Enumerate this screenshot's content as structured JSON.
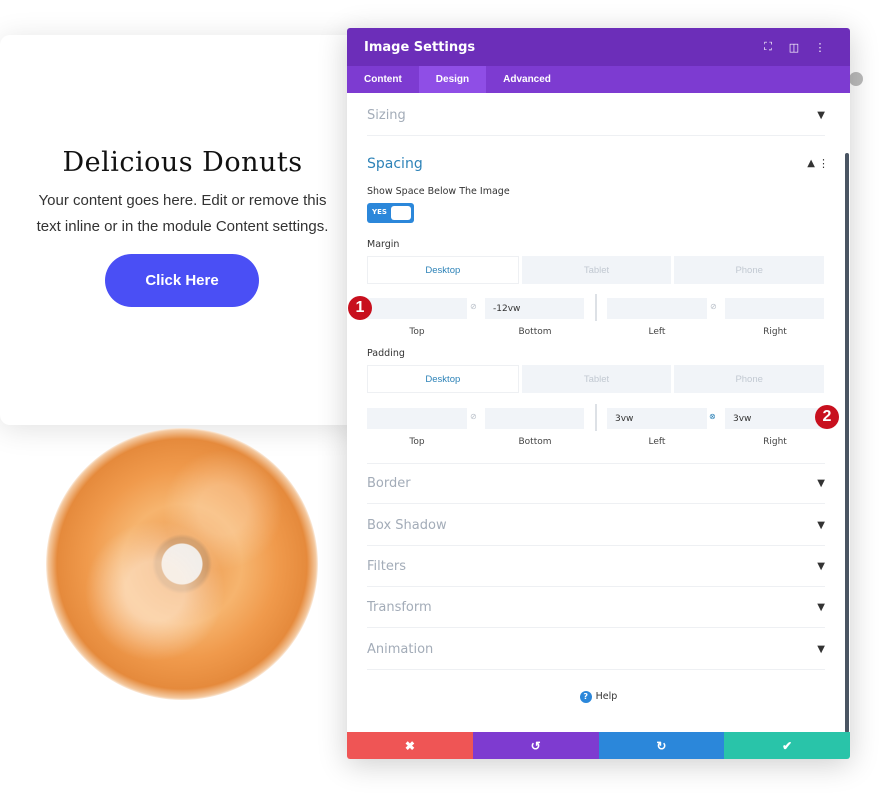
{
  "preview": {
    "heading": "Delicious Donuts",
    "body": "Your content goes here. Edit or remove this text inline or in the module Content settings.",
    "button": "Click Here"
  },
  "panel": {
    "title": "Image Settings",
    "tabs": [
      "Content",
      "Design",
      "Advanced"
    ],
    "active_tab": "Design",
    "sections": {
      "sizing": "Sizing",
      "spacing": "Spacing",
      "border": "Border",
      "box_shadow": "Box Shadow",
      "filters": "Filters",
      "transform": "Transform",
      "animation": "Animation"
    },
    "show_space_label": "Show Space Below The Image",
    "toggle": "YES",
    "margin": {
      "label": "Margin",
      "devices": [
        "Desktop",
        "Tablet",
        "Phone"
      ],
      "top": "",
      "bottom": "-12vw",
      "left": "",
      "right": ""
    },
    "padding": {
      "label": "Padding",
      "devices": [
        "Desktop",
        "Tablet",
        "Phone"
      ],
      "top": "",
      "bottom": "",
      "left": "3vw",
      "right": "3vw"
    },
    "sides": [
      "Top",
      "Bottom",
      "Left",
      "Right"
    ],
    "help": "Help"
  },
  "badges": [
    "1",
    "2"
  ],
  "colors": {
    "header": "#6c2eb9",
    "tabs": "#7d3bd1",
    "accent": "#2b87da",
    "cancel": "#ef5555",
    "undo": "#7e3bd0",
    "redo": "#2b87da",
    "save": "#29c4a9",
    "cta": "#4a4ff5"
  }
}
